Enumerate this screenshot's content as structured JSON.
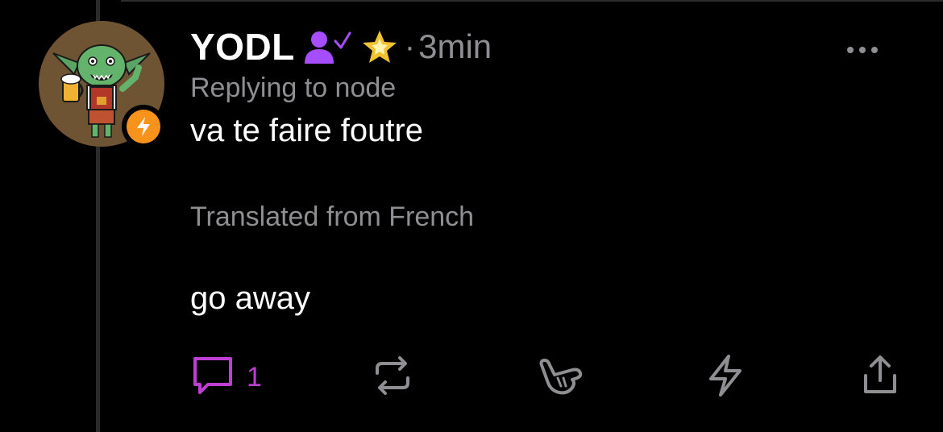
{
  "post": {
    "username": "YODL",
    "separator": "·",
    "time": "3min",
    "replying_to": "Replying to node",
    "text": "va te faire foutre",
    "translated_label": "Translated from French",
    "translated_text": "go away"
  },
  "actions": {
    "reply_count": "1"
  },
  "icons": {
    "verified": "person-check-icon",
    "star": "star-icon",
    "more": "more-horizontal-icon",
    "zap_badge": "lightning-icon",
    "reply": "comment-icon",
    "repost": "repost-icon",
    "react": "shaka-hand-icon",
    "zap": "lightning-icon",
    "share": "share-icon"
  },
  "colors": {
    "background": "#000000",
    "text": "#ffffff",
    "muted": "#8e8e93",
    "accent_purple": "#bf3fd4",
    "verified_purple": "#a64dff",
    "star_gold": "#f2c230",
    "zap_orange": "#f7931a"
  }
}
